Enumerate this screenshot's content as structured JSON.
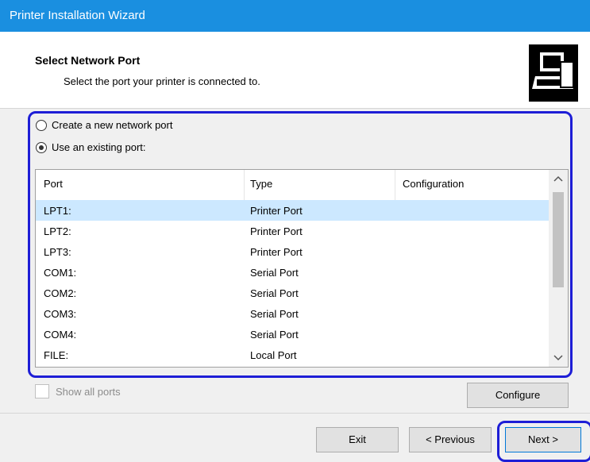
{
  "window": {
    "title": "Printer Installation Wizard"
  },
  "header": {
    "title": "Select Network Port",
    "subtitle": "Select the port your printer is connected to."
  },
  "options": {
    "create_new": {
      "label": "Create a new network port",
      "selected": false
    },
    "use_existing": {
      "label": "Use an existing port:",
      "selected": true
    }
  },
  "port_list": {
    "columns": [
      "Port",
      "Type",
      "Configuration"
    ],
    "rows": [
      {
        "port": "LPT1:",
        "type": "Printer Port",
        "config": ""
      },
      {
        "port": "LPT2:",
        "type": "Printer Port",
        "config": ""
      },
      {
        "port": "LPT3:",
        "type": "Printer Port",
        "config": ""
      },
      {
        "port": "COM1:",
        "type": "Serial Port",
        "config": ""
      },
      {
        "port": "COM2:",
        "type": "Serial Port",
        "config": ""
      },
      {
        "port": "COM3:",
        "type": "Serial Port",
        "config": ""
      },
      {
        "port": "COM4:",
        "type": "Serial Port",
        "config": ""
      },
      {
        "port": "FILE:",
        "type": "Local Port",
        "config": ""
      }
    ],
    "selected_index": 0
  },
  "show_all_ports": {
    "label": "Show all ports",
    "checked": false,
    "enabled": false
  },
  "buttons": {
    "configure": "Configure",
    "exit": "Exit",
    "previous": "< Previous",
    "next": "Next >"
  },
  "colors": {
    "titlebar": "#1a8fe0",
    "highlight": "#1e1ed6",
    "selection": "#cce8ff"
  },
  "icons": {
    "wizard_logo": "computer-printer-icon",
    "scroll_up": "chevron-up-icon",
    "scroll_down": "chevron-down-icon"
  }
}
